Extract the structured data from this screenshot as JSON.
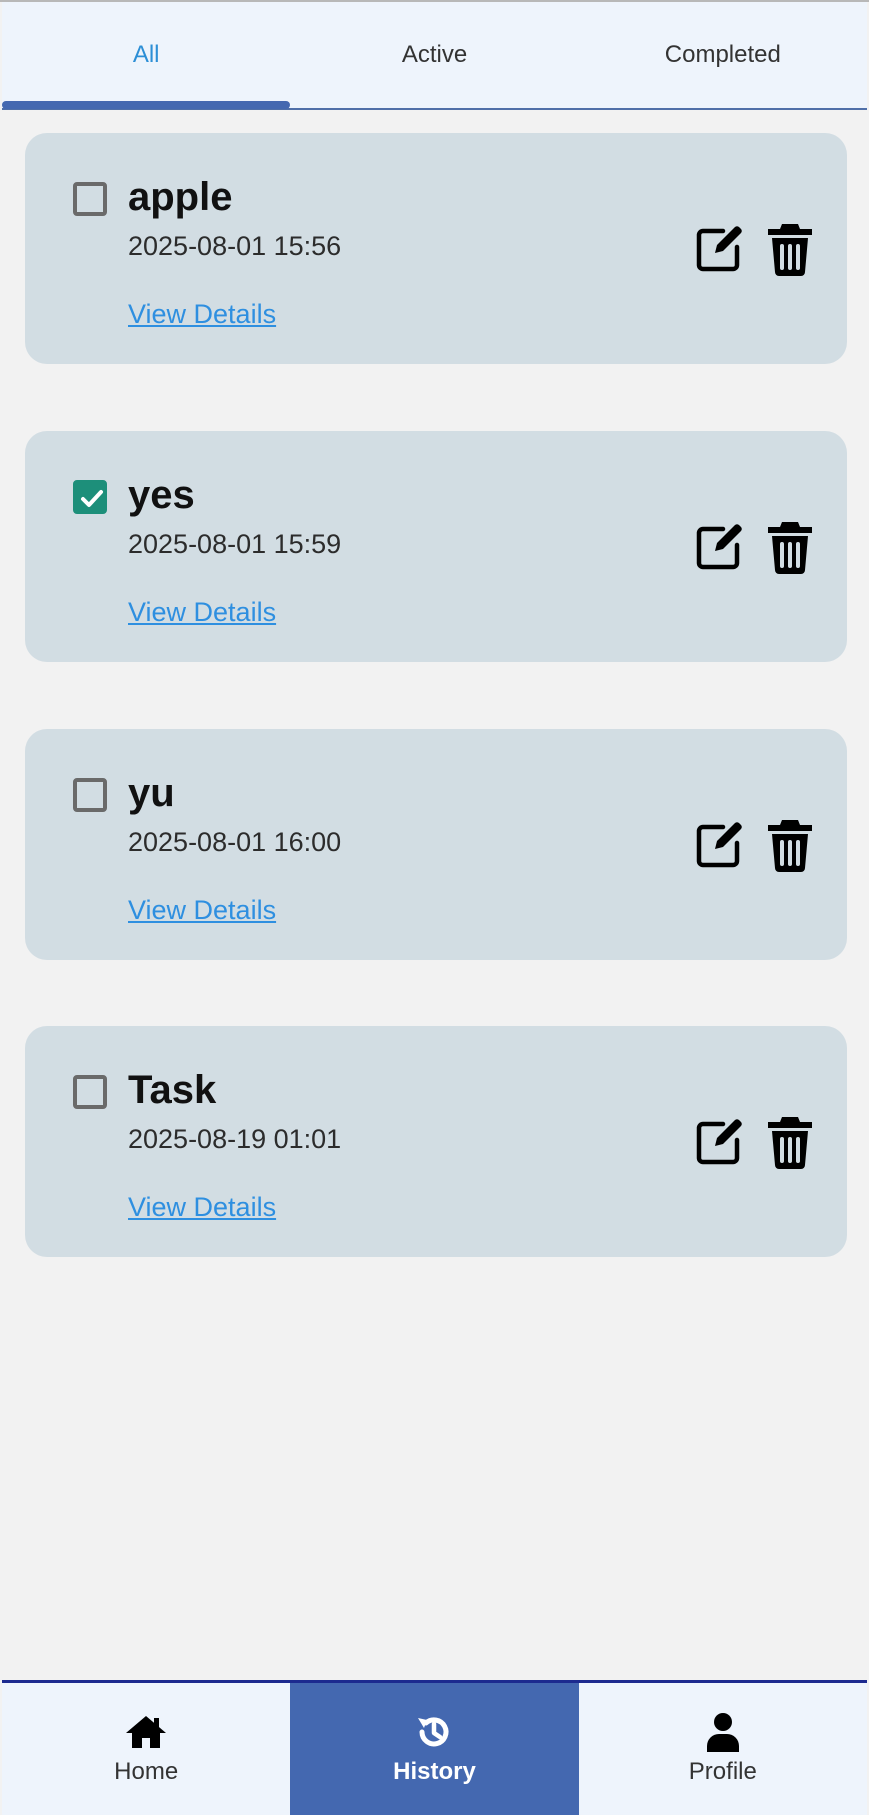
{
  "tabs": [
    {
      "label": "All",
      "active": true
    },
    {
      "label": "Active",
      "active": false
    },
    {
      "label": "Completed",
      "active": false
    }
  ],
  "tasks": [
    {
      "title": "apple",
      "datetime": "2025-08-01 15:56",
      "completed": false,
      "details_label": "View Details"
    },
    {
      "title": "yes",
      "datetime": "2025-08-01 15:59",
      "completed": true,
      "details_label": "View Details"
    },
    {
      "title": "yu",
      "datetime": "2025-08-01 16:00",
      "completed": false,
      "details_label": "View Details"
    },
    {
      "title": "Task",
      "datetime": "2025-08-19 01:01",
      "completed": false,
      "details_label": "View Details"
    }
  ],
  "bottom_nav": [
    {
      "label": "Home",
      "icon": "home-icon",
      "active": false
    },
    {
      "label": "History",
      "icon": "history-icon",
      "active": true
    },
    {
      "label": "Profile",
      "icon": "person-icon",
      "active": false
    }
  ],
  "colors": {
    "accent": "#4468b0",
    "checked": "#1d8f7a",
    "link": "#2e8fe0",
    "card": "#d2dde3"
  }
}
